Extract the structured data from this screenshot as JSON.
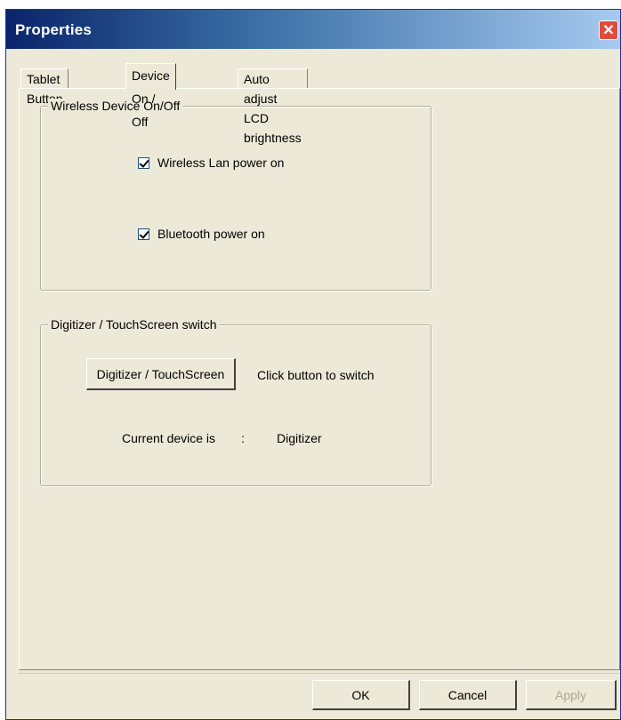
{
  "window": {
    "title": "Properties",
    "close_glyph": "✕"
  },
  "tabs": [
    {
      "label": "Tablet Button",
      "active": false
    },
    {
      "label": "Device On / Off",
      "active": true
    },
    {
      "label": "Auto adjust LCD brightness",
      "active": false
    }
  ],
  "wireless": {
    "group_label": "Wireless Device On/Off",
    "wlan_label": "Wireless Lan power on",
    "wlan_checked": true,
    "bt_label": "Bluetooth power on",
    "bt_checked": true
  },
  "digitizer": {
    "group_label": "Digitizer / TouchScreen switch",
    "switch_button_label": "Digitizer / TouchScreen",
    "hint": "Click button to switch",
    "current_label": "Current device is",
    "separator": ":",
    "current_value": "Digitizer"
  },
  "footer": {
    "ok": "OK",
    "cancel": "Cancel",
    "apply": "Apply",
    "apply_enabled": false
  },
  "colors": {
    "titlebar_start": "#0a246a",
    "titlebar_end": "#a6caf0",
    "dialog_bg": "#ece9d8",
    "close_red": "#e24a3b"
  }
}
